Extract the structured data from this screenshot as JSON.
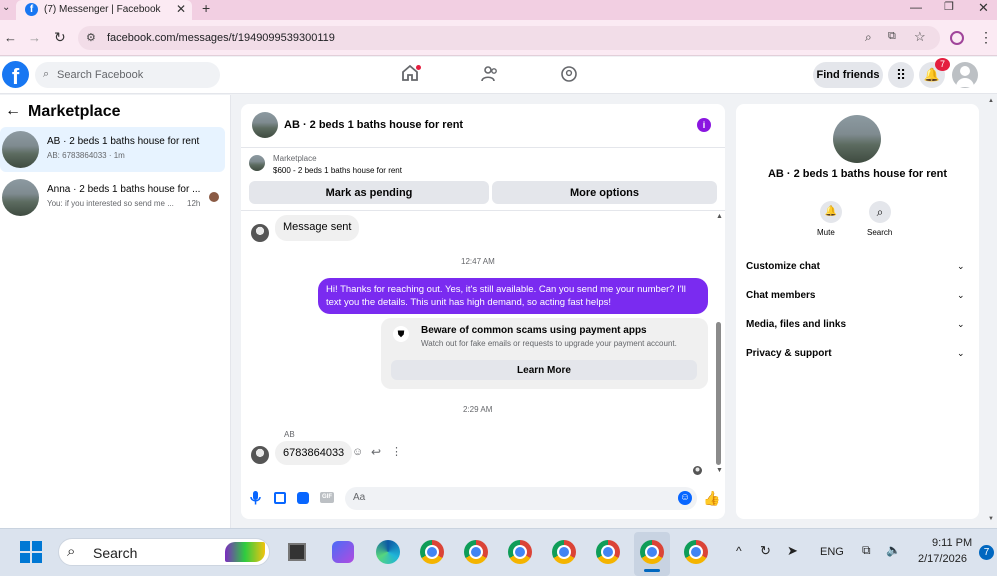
{
  "browser": {
    "tab_title": "(7) Messenger | Facebook",
    "new_tab": "+",
    "url": "facebook.com/messages/t/1949099539300119",
    "window_controls": [
      "minimize",
      "restore",
      "close"
    ]
  },
  "fb_header": {
    "search_placeholder": "Search Facebook",
    "find_friends": "Find friends",
    "notification_count": "7",
    "accent_color": "#1877f2"
  },
  "sidebar": {
    "title": "Marketplace",
    "conversations": [
      {
        "title": "AB · 2 beds 1 baths house for rent",
        "preview": "AB: 6783864033 · 1m",
        "selected": true
      },
      {
        "title": "Anna · 2 beds 1 baths house for ...",
        "preview": "You: if you interested so send me ...",
        "time": "12h",
        "selected": false
      }
    ]
  },
  "chat": {
    "header_title": "AB · 2 beds 1 baths house for rent",
    "listing_source": "Marketplace",
    "listing_desc": "$600 - 2 beds 1 baths house for rent",
    "mark_pending": "Mark as pending",
    "more_options": "More options",
    "messages": {
      "sent_notice": "Message sent",
      "time_1": "12:47 AM",
      "outgoing": "Hi! Thanks for reaching out. Yes, it's still available. Can you send me your number? I'll text you the details. This unit has high demand, so acting fast helps!",
      "warning_title": "Beware of common scams using payment apps",
      "warning_body": "Watch out for fake emails or requests to upgrade your payment account.",
      "learn_more": "Learn More",
      "time_2": "2:29 AM",
      "sender_name": "AB",
      "incoming": "6783864033"
    },
    "composer_placeholder": "Aa",
    "outgoing_color": "#7a2bf0"
  },
  "info_panel": {
    "title": "AB · 2 beds 1 baths house for rent",
    "mute": "Mute",
    "search": "Search",
    "sections": [
      "Customize chat",
      "Chat members",
      "Media, files and links",
      "Privacy & support"
    ]
  },
  "taskbar": {
    "search": "Search",
    "language": "ENG",
    "time": "9:11 PM",
    "date": "2/17/2026",
    "notification_count": "7"
  }
}
